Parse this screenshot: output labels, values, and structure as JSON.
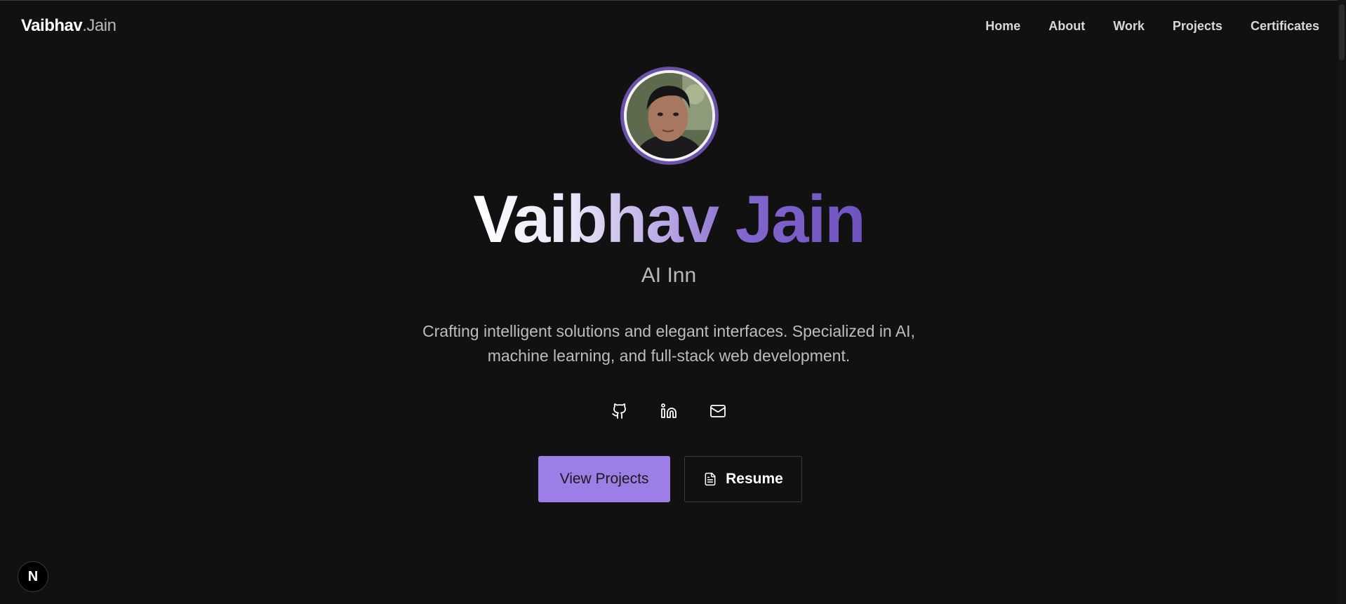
{
  "header": {
    "logo_first": "Vaibhav",
    "logo_last": ".Jain",
    "nav": [
      {
        "label": "Home"
      },
      {
        "label": "About"
      },
      {
        "label": "Work"
      },
      {
        "label": "Projects"
      },
      {
        "label": "Certificates"
      }
    ]
  },
  "hero": {
    "avatar_icon": "profile-photo",
    "name": "Vaibhav Jain",
    "subtitle": "AI Inn",
    "description_line1": "Crafting intelligent solutions and elegant interfaces. Specialized in AI,",
    "description_line2": "machine learning, and full-stack web development.",
    "socials": [
      {
        "icon": "github-icon"
      },
      {
        "icon": "linkedin-icon"
      },
      {
        "icon": "mail-icon"
      }
    ],
    "primary_button": "View Projects",
    "secondary_button": "Resume",
    "secondary_button_icon": "file-text-icon"
  },
  "dev_badge": "N",
  "colors": {
    "background": "#111111",
    "accent": "#9d7ee6",
    "avatar_ring": "#6a52a8",
    "gradient_end": "#6e53c0"
  }
}
